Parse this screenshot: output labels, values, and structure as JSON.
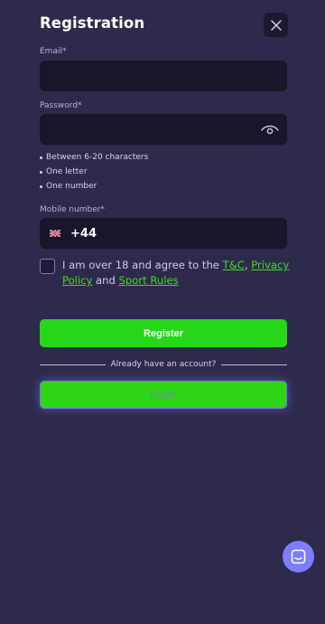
{
  "header": {
    "title": "Registration",
    "close_icon": "close-icon"
  },
  "form": {
    "email": {
      "label": "Email*",
      "value": "",
      "placeholder": ""
    },
    "password": {
      "label": "Password*",
      "value": "",
      "placeholder": "",
      "toggle_icon": "eye-icon",
      "rules": [
        "Between 6-20 characters",
        "One letter",
        "One number"
      ]
    },
    "mobile": {
      "label": "Mobile number*",
      "flag_icon": "uk-flag-icon",
      "country_code": "+44",
      "value": ""
    },
    "terms": {
      "text_before": "I am over 18 and agree to the ",
      "tc_link": "T&C",
      "comma": ", ",
      "privacy_link": "Privacy Policy",
      "and": " and ",
      "sport_link": "Sport Rules",
      "checked": false
    },
    "register_label": "Register",
    "divider_text": "Already have an account?",
    "login_label": "Login"
  },
  "chat": {
    "icon": "chat-icon"
  },
  "colors": {
    "background": "#2e2a4b",
    "input_bg": "#17162a",
    "accent_green": "#27d71a",
    "link_green": "#3fdd1e",
    "chat_bubble": "#7c7eff"
  }
}
